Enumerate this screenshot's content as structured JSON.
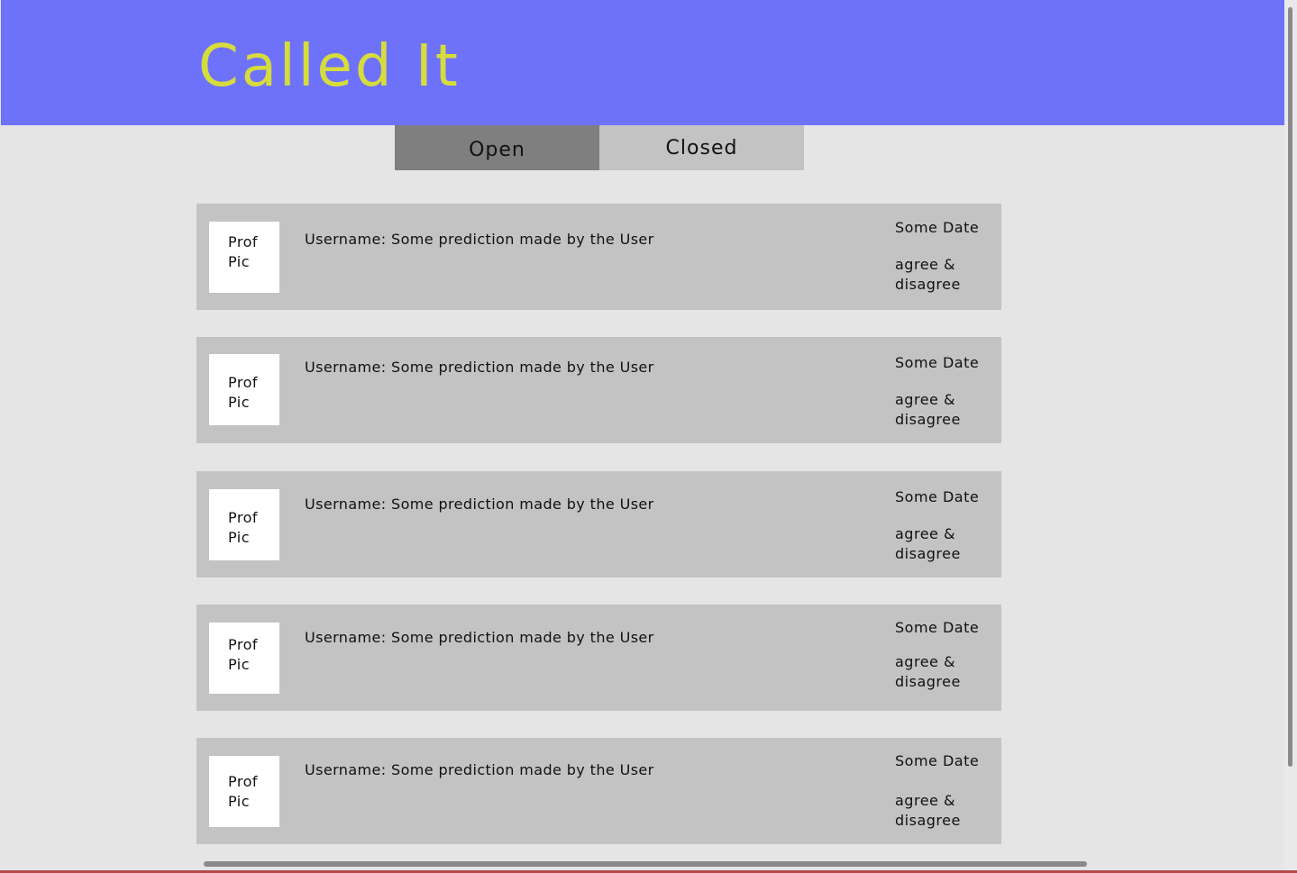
{
  "app": {
    "title": "Called It",
    "header_color": "#6e72fb",
    "title_color": "#d6dc3c"
  },
  "tabs": [
    {
      "label": "Open",
      "active": true
    },
    {
      "label": "Closed",
      "active": false
    }
  ],
  "predictions": [
    {
      "avatar_line1": "Prof",
      "avatar_line2": "Pic",
      "text": "Username: Some prediction made by the User",
      "date": "Some Date",
      "votes": "agree & disagree"
    },
    {
      "avatar_line1": "Prof",
      "avatar_line2": "Pic",
      "text": "Username: Some prediction made by the User",
      "date": "Some Date",
      "votes": "agree & disagree"
    },
    {
      "avatar_line1": "Prof",
      "avatar_line2": "Pic",
      "text": "Username: Some prediction made by the User",
      "date": "Some Date",
      "votes": "agree & disagree"
    },
    {
      "avatar_line1": "Prof",
      "avatar_line2": "Pic",
      "text": "Username: Some prediction made by the User",
      "date": "Some Date",
      "votes": "agree & disagree"
    },
    {
      "avatar_line1": "Prof",
      "avatar_line2": "Pic",
      "text": "Username: Some prediction made by the User",
      "date": "Some Date",
      "votes": "agree & disagree"
    }
  ]
}
